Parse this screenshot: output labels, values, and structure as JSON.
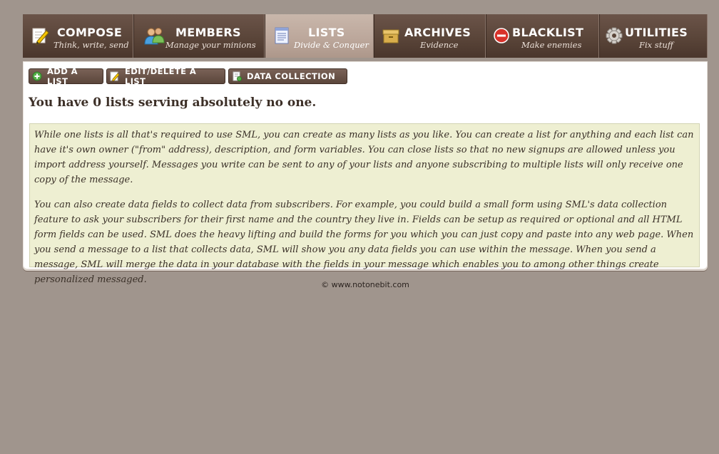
{
  "nav": {
    "tabs": [
      {
        "key": "compose",
        "label": "COMPOSE",
        "subtitle": "Think, write, send",
        "icon": "compose-icon",
        "active": false
      },
      {
        "key": "members",
        "label": "MEMBERS",
        "subtitle": "Manage your minions",
        "icon": "members-icon",
        "active": false
      },
      {
        "key": "lists",
        "label": "LISTS",
        "subtitle": "Divide & Conquer",
        "icon": "lists-icon",
        "active": true
      },
      {
        "key": "archives",
        "label": "ARCHIVES",
        "subtitle": "Evidence",
        "icon": "archives-icon",
        "active": false
      },
      {
        "key": "blacklist",
        "label": "BLACKLIST",
        "subtitle": "Make enemies",
        "icon": "blacklist-icon",
        "active": false
      },
      {
        "key": "utilities",
        "label": "UTILITIES",
        "subtitle": "Fix stuff",
        "icon": "gear-icon",
        "active": false
      }
    ]
  },
  "toolbar": {
    "add_label": "ADD A LIST",
    "edit_label": "EDIT/DELETE A LIST",
    "data_label": "DATA COLLECTION"
  },
  "main": {
    "headline": "You have 0 lists serving absolutely no one.",
    "paragraphs": [
      "While one lists is all that's required to use SML, you can create as many lists as you like. You can create a list for anything and each list can have it's own owner (\"from\" address), description, and form variables. You can close lists so that no new signups are allowed unless you import address yourself. Messages you write can be sent to any of your lists and anyone subscribing to multiple lists will only receive one copy of the message.",
      "You can also create data fields to collect data from subscribers. For example, you could build a small form using SML's data collection feature to ask your subscribers for their first name and the country they live in. Fields can be setup as required or optional and all HTML form fields can be used. SML does the heavy lifting and build the forms for you which you can just copy and paste into any web page. When you send a message to a list that collects data, SML will show you any data fields you can use within the message. When you send a message, SML will merge the data in your database with the fields in your message which enables you to among other things create personalized messaged."
    ]
  },
  "footer": {
    "text": "© www.notonebit.com"
  },
  "colors": {
    "background": "#a0958d",
    "tab_dark": "#5a4539",
    "tab_active": "#bba69a",
    "info_bg": "#eeefd2",
    "button_bg": "#5b463b"
  }
}
